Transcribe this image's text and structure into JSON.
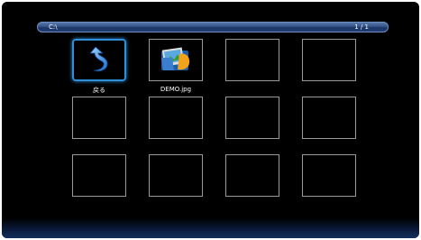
{
  "path_bar": {
    "path": "C:\\",
    "page_indicator": "1 / 1"
  },
  "items": [
    {
      "label": "戻る",
      "icon": "back-arrow-icon",
      "selected": true
    },
    {
      "label": "DEMO.jpg",
      "icon": "image-folder-icon",
      "selected": false
    }
  ],
  "colors": {
    "background": "#000000",
    "selection": "#2f8fd8",
    "tile_border": "#9a9a9a",
    "path_bar": "#34548a"
  }
}
